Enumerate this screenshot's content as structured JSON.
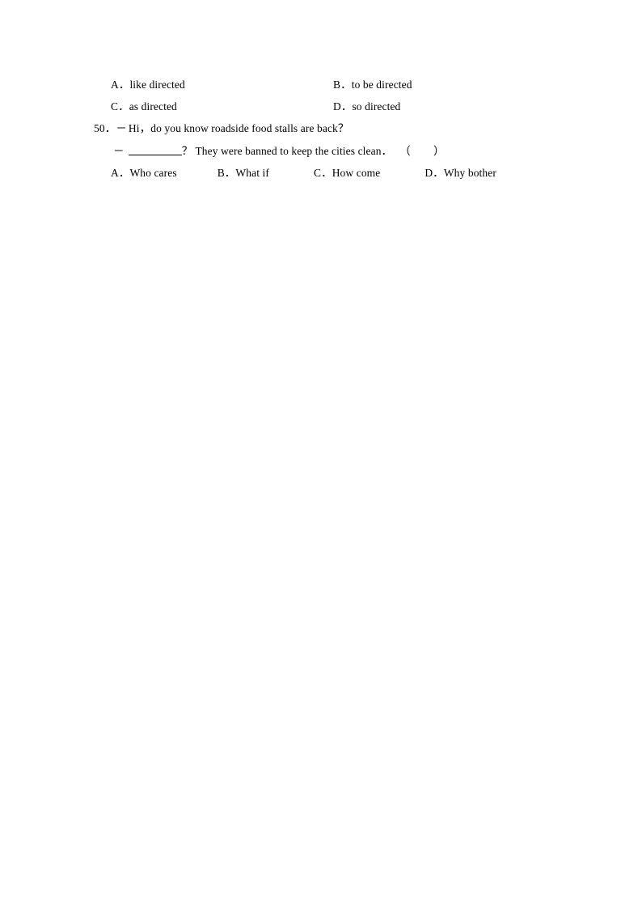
{
  "document": {
    "type": "exam-worksheet",
    "page_background": "#ffffff",
    "text_color": "#000000"
  },
  "question_49_options": {
    "a": {
      "label": "A．",
      "text": "like directed"
    },
    "b": {
      "label": "B．",
      "text": "to be directed"
    },
    "c": {
      "label": "C．",
      "text": "as directed"
    },
    "d": {
      "label": "D．",
      "text": "so directed"
    }
  },
  "question_50": {
    "number": "50．",
    "speaker_dash_1": "－",
    "prompt": "Hi，do you know roadside food stalls are back？",
    "speaker_dash_2": "－",
    "reply_after_blank": "？ They were banned to keep the cities clean．",
    "answer_parentheses": "（　　）",
    "options": {
      "a": {
        "label": "A．",
        "text": "Who cares"
      },
      "b": {
        "label": "B．",
        "text": "What if"
      },
      "c": {
        "label": "C．",
        "text": "How come"
      },
      "d": {
        "label": "D．",
        "text": "Why bother"
      }
    }
  }
}
